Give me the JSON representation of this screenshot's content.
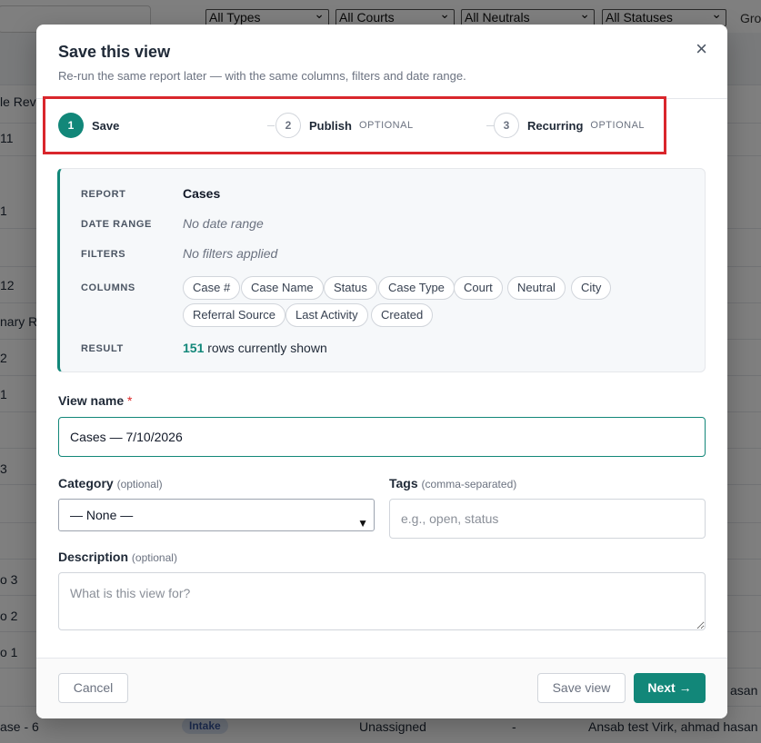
{
  "background": {
    "filters": [
      "All Types",
      "All Courts",
      "All Neutrals",
      "All Statuses"
    ],
    "group_label": "Gro",
    "row_fragments": [
      "le Revi",
      "11",
      "1",
      "12",
      "nary Re",
      "2",
      "1",
      "3",
      "o 3",
      "o 2",
      "o 1",
      "asan",
      "ase - 6"
    ],
    "last_row": {
      "case": "ase - 6",
      "badge": "Intake",
      "neutral": "Unassigned",
      "dash": "-",
      "people": "Ansab test Virk, ahmad hasan"
    }
  },
  "modal": {
    "title": "Save this view",
    "subtitle": "Re-run the same report later — with the same columns, filters and date range.",
    "close_icon": "×",
    "steps": [
      {
        "number": "1",
        "label": "Save",
        "optional": "",
        "active": true
      },
      {
        "number": "2",
        "label": "Publish",
        "optional": "OPTIONAL",
        "active": false
      },
      {
        "number": "3",
        "label": "Recurring",
        "optional": "OPTIONAL",
        "active": false
      }
    ],
    "summary": {
      "report_label": "REPORT",
      "report_value": "Cases",
      "date_range_label": "DATE RANGE",
      "date_range_value": "No date range",
      "filters_label": "FILTERS",
      "filters_value": "No filters applied",
      "columns_label": "COLUMNS",
      "columns": [
        "Case #",
        "Case Name",
        "Status",
        "Case Type",
        "Court",
        "Neutral",
        "City",
        "Referral Source",
        "Last Activity",
        "Created"
      ],
      "result_label": "RESULT",
      "result_count": "151",
      "result_suffix": "rows currently shown"
    },
    "form": {
      "view_name_label": "View name",
      "required_mark": "*",
      "view_name_value": "Cases — 7/10/2026",
      "category_label": "Category",
      "category_hint": "(optional)",
      "category_selected": "— None —",
      "tags_label": "Tags",
      "tags_hint": "(comma-separated)",
      "tags_placeholder": "e.g., open, status",
      "description_label": "Description",
      "description_hint": "(optional)",
      "description_placeholder": "What is this view for?"
    },
    "footer": {
      "cancel_label": "Cancel",
      "save_view_label": "Save view",
      "next_label": "Next →"
    }
  },
  "colors": {
    "accent": "#128779",
    "highlight_border": "#d9262c",
    "required": "#dc2626"
  }
}
